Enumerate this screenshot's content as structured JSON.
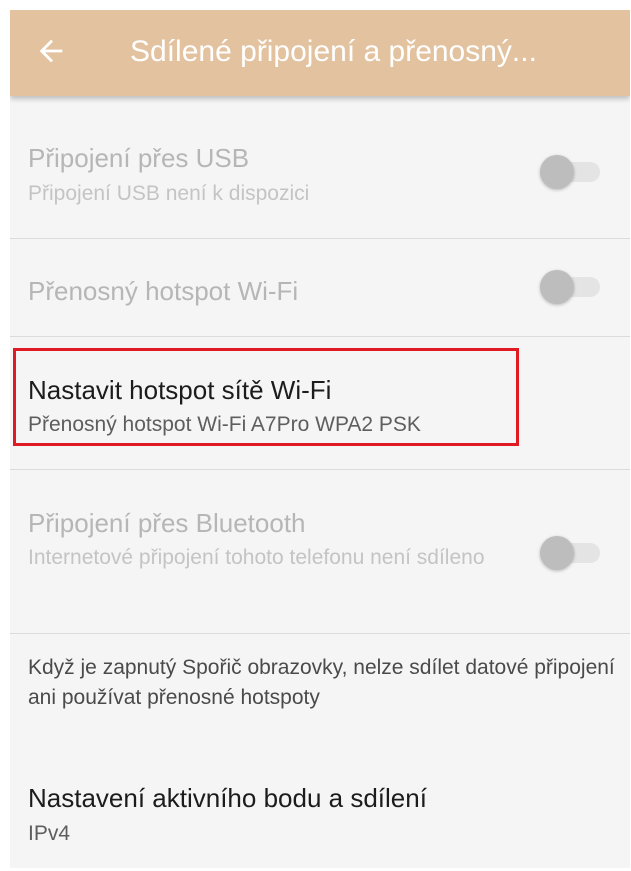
{
  "appbar": {
    "title": "Sdílené připojení a přenosný...",
    "back_icon": "arrow-left-icon"
  },
  "settings": {
    "usb": {
      "title": "Připojení přes USB",
      "summary": "Připojení USB není k dispozici",
      "enabled": false,
      "switch_on": false
    },
    "wifi_hotspot": {
      "title": "Přenosný hotspot Wi-Fi",
      "enabled": false,
      "switch_on": false
    },
    "setup_hotspot": {
      "title": "Nastavit hotspot sítě Wi-Fi",
      "summary": "Přenosný hotspot Wi-Fi A7Pro WPA2 PSK",
      "enabled": true,
      "highlighted": true
    },
    "bluetooth": {
      "title": "Připojení přes Bluetooth",
      "summary": "Internetové připojení tohoto telefonu není sdíleno",
      "enabled": false,
      "switch_on": false
    },
    "battery_note": "Když je zapnutý Spořič obrazovky, nelze sdílet datové připojení ani používat přenosné hotspoty",
    "hotspot_settings": {
      "title": "Nastavení aktivního bodu a sdílení",
      "summary": "IPv4",
      "enabled": true
    }
  },
  "colors": {
    "appbar": "#e3c29f",
    "background": "#f5f5f5",
    "highlight": "#e01b24"
  }
}
